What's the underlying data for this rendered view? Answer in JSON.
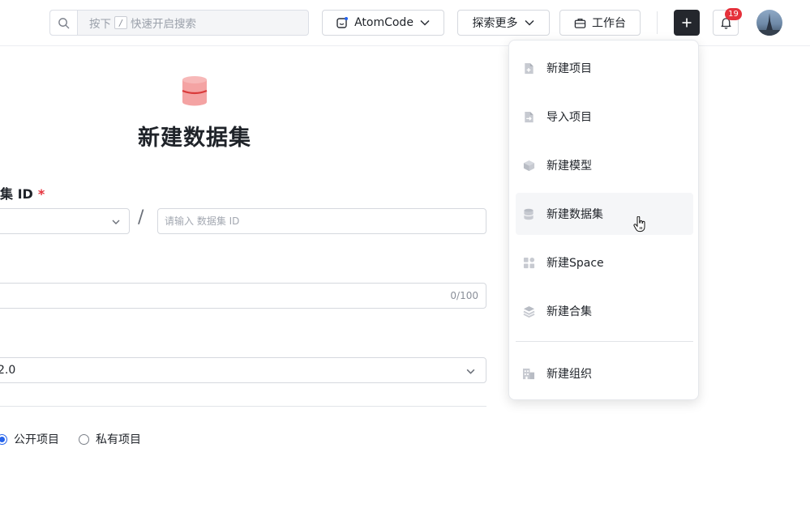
{
  "header": {
    "search": {
      "prefix": "按下",
      "key": "/",
      "suffix": "快速开启搜索"
    },
    "atomcode_label": "AtomCode",
    "explore_label": "探索更多",
    "workbench_label": "工作台",
    "notification_count": "19"
  },
  "form": {
    "title": "新建数据集",
    "id_label": "集 ID",
    "required_mark": "*",
    "slash": "/",
    "id_placeholder": "请输入 数据集 ID",
    "name_counter": "0/100",
    "license_value": "2.0",
    "visibility": {
      "public_label": "公开项目",
      "private_label": "私有项目",
      "selected": "public"
    }
  },
  "menu": {
    "items": [
      {
        "label": "新建项目",
        "icon": "new-project-icon"
      },
      {
        "label": "导入项目",
        "icon": "import-project-icon"
      },
      {
        "label": "新建模型",
        "icon": "model-cube-icon"
      },
      {
        "label": "新建数据集",
        "icon": "database-icon"
      },
      {
        "label": "新建Space",
        "icon": "space-grid-icon"
      },
      {
        "label": "新建合集",
        "icon": "layers-icon"
      }
    ],
    "org_item": {
      "label": "新建组织",
      "icon": "building-icon"
    },
    "hovered_index": 3
  },
  "colors": {
    "accent_blue": "#2563eb",
    "dark_button": "#24272d",
    "badge_red": "#e5313b",
    "dataset_icon": "#f07a7a"
  }
}
